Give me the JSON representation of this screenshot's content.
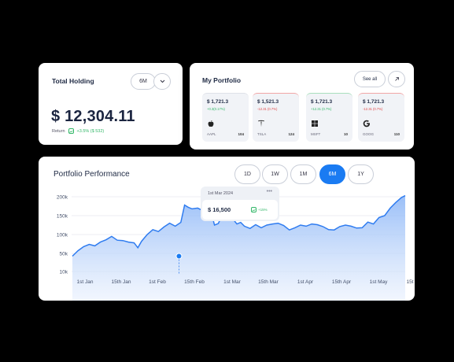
{
  "holding": {
    "title": "Total Holding",
    "period": "6M",
    "amount": "$ 12,304.11",
    "return_label": "Return",
    "return_value": "+3.5% ($ 532)"
  },
  "portfolio": {
    "title": "My Portfolio",
    "see_all": "See all",
    "stocks": [
      {
        "price": "$ 1,721.3",
        "change": "+0.3(0.17%)",
        "ticker": "AAPL",
        "qty": "104",
        "logo": "apple-icon"
      },
      {
        "price": "$ 1,521.3",
        "change": "-12.31 (0.7%)",
        "ticker": "TSLA",
        "qty": "124",
        "logo": "tesla-icon"
      },
      {
        "price": "$ 1,721.3",
        "change": "+12.31 (0.7%)",
        "ticker": "MSFT",
        "qty": "10",
        "logo": "windows-icon"
      },
      {
        "price": "$ 1,721.3",
        "change": "-12.31 (0.7%)",
        "ticker": "GOOG",
        "qty": "110",
        "logo": "google-icon"
      }
    ]
  },
  "performance": {
    "title": "Portfolio Performance",
    "ranges": [
      "1D",
      "1W",
      "1M",
      "6M",
      "1Y"
    ],
    "active_range": "6M",
    "tooltip": {
      "date": "1st Mar 2024",
      "dots": "•••",
      "value": "$ 16,500",
      "change": "+15%"
    }
  },
  "colors": {
    "accent": "#1a7bf2",
    "positive": "#32b768",
    "negative": "#e04848"
  },
  "chart_data": {
    "type": "area",
    "y_ticks": [
      "200k",
      "150k",
      "100k",
      "50k",
      "10k"
    ],
    "x_ticks": [
      "1st Jan",
      "15th Jan",
      "1st Feb",
      "15th Feb",
      "1st Mar",
      "15th Mar",
      "1st Apr",
      "15th Apr",
      "1st May",
      "15t"
    ],
    "ylim": [
      10000,
      200000
    ],
    "series": [
      {
        "values": [
          [
            0,
            44000
          ],
          [
            3,
            57000
          ],
          [
            6,
            68000
          ],
          [
            9,
            74000
          ],
          [
            12,
            70000
          ],
          [
            15,
            80000
          ],
          [
            18,
            86000
          ],
          [
            21,
            95000
          ],
          [
            24,
            85000
          ],
          [
            27,
            84000
          ],
          [
            30,
            80000
          ],
          [
            33,
            78000
          ],
          [
            35,
            65000
          ],
          [
            37,
            82000
          ],
          [
            40,
            100000
          ],
          [
            43,
            113000
          ],
          [
            46,
            108000
          ],
          [
            49,
            120000
          ],
          [
            52,
            130000
          ],
          [
            55,
            122000
          ],
          [
            58,
            132000
          ],
          [
            60,
            178000
          ],
          [
            62,
            172000
          ],
          [
            64,
            168000
          ],
          [
            67,
            170000
          ],
          [
            70,
            163000
          ],
          [
            72,
            175000
          ],
          [
            74,
            163000
          ],
          [
            76,
            125000
          ],
          [
            78,
            129000
          ],
          [
            80,
            150000
          ],
          [
            82,
            162000
          ],
          [
            84,
            148000
          ],
          [
            86,
            140000
          ],
          [
            88,
            128000
          ],
          [
            90,
            132000
          ],
          [
            92,
            122000
          ],
          [
            95,
            116000
          ],
          [
            98,
            126000
          ],
          [
            101,
            118000
          ],
          [
            104,
            125000
          ],
          [
            107,
            128000
          ],
          [
            110,
            130000
          ],
          [
            113,
            124000
          ],
          [
            116,
            112000
          ],
          [
            119,
            118000
          ],
          [
            122,
            125000
          ],
          [
            125,
            122000
          ],
          [
            128,
            128000
          ],
          [
            131,
            126000
          ],
          [
            134,
            121000
          ],
          [
            137,
            113000
          ],
          [
            140,
            112000
          ],
          [
            143,
            121000
          ],
          [
            146,
            125000
          ],
          [
            149,
            122000
          ],
          [
            152,
            117000
          ],
          [
            155,
            118000
          ],
          [
            158,
            133000
          ],
          [
            161,
            128000
          ],
          [
            164,
            145000
          ],
          [
            167,
            150000
          ],
          [
            170,
            170000
          ],
          [
            173,
            185000
          ],
          [
            176,
            198000
          ],
          [
            178,
            203000
          ]
        ]
      }
    ],
    "highlight_x": 57,
    "grid": true
  }
}
